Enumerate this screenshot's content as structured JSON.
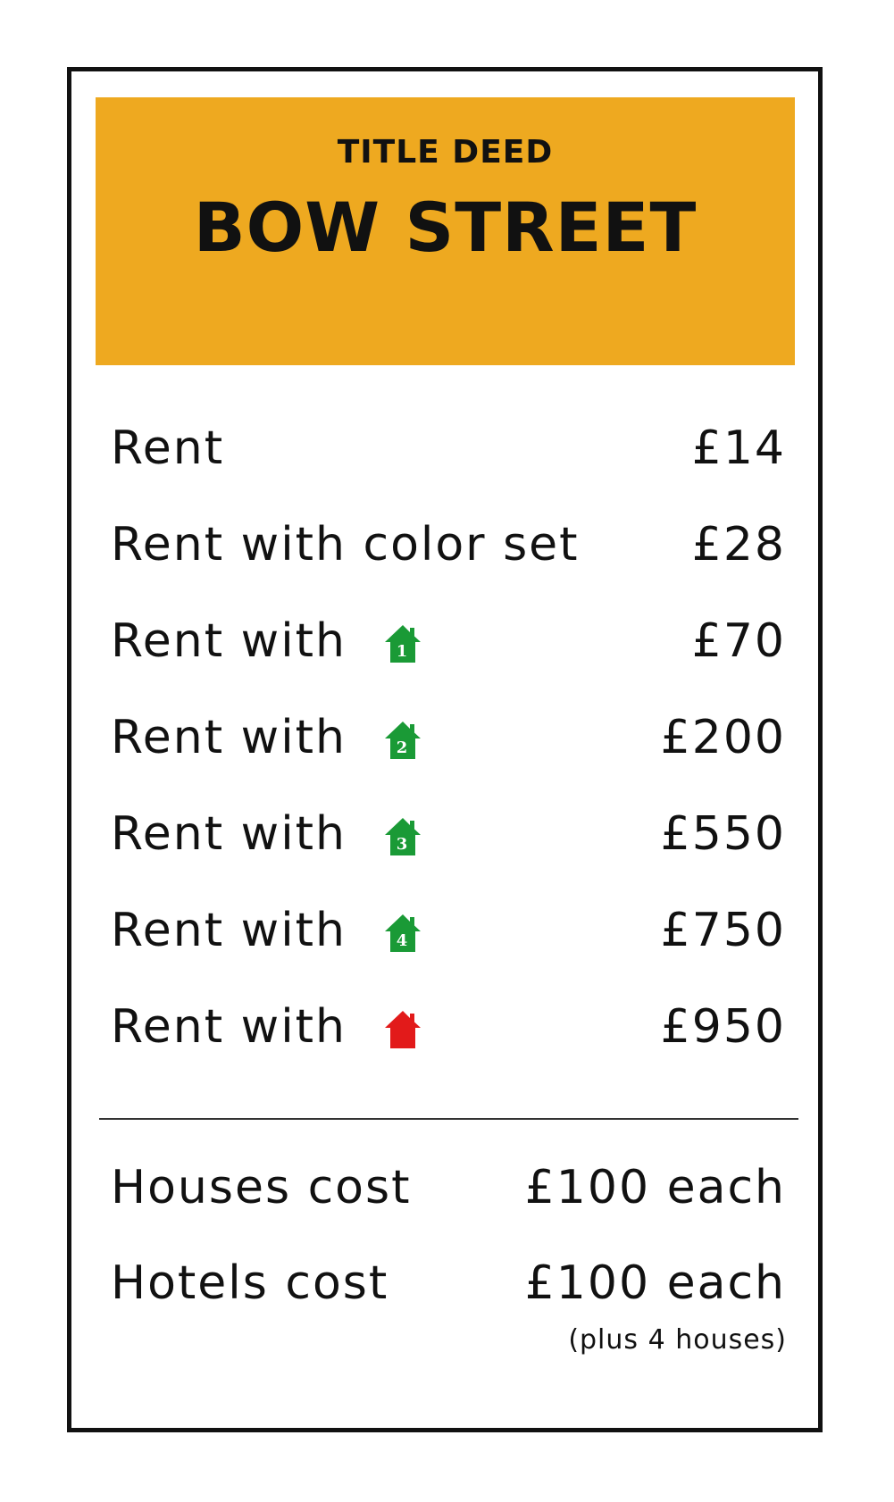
{
  "colors": {
    "header_bg": "#EEA920",
    "house_green": "#1A9A36",
    "hotel_red": "#E21A1A",
    "border": "#111111"
  },
  "header": {
    "label": "TITLE DEED",
    "name": "BOW STREET"
  },
  "rents": [
    {
      "label": "Rent",
      "value": "£14"
    },
    {
      "label": "Rent with color set",
      "value": "£28"
    },
    {
      "label": "Rent with",
      "icon": "house-icon",
      "icon_number": "1",
      "value": "£70"
    },
    {
      "label": "Rent with",
      "icon": "house-icon",
      "icon_number": "2",
      "value": "£200"
    },
    {
      "label": "Rent with",
      "icon": "house-icon",
      "icon_number": "3",
      "value": "£550"
    },
    {
      "label": "Rent with",
      "icon": "house-icon",
      "icon_number": "4",
      "value": "£750"
    },
    {
      "label": "Rent with",
      "icon": "hotel-icon",
      "value": "£950"
    }
  ],
  "costs": {
    "houses": {
      "label": "Houses cost",
      "value": "£100 each"
    },
    "hotels": {
      "label": "Hotels cost",
      "value": "£100 each",
      "note": "(plus 4 houses)"
    }
  }
}
